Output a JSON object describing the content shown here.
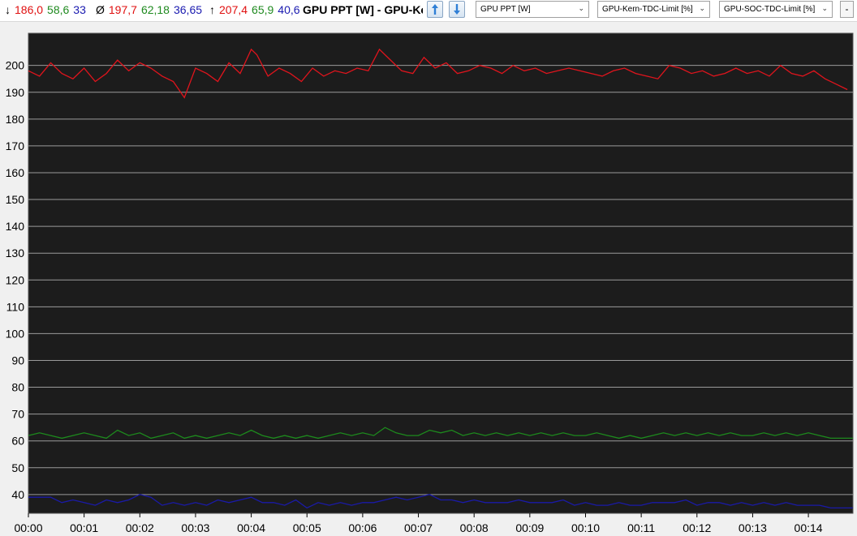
{
  "stats": {
    "min": {
      "symbol": "↓",
      "v1": "186,0",
      "v2": "58,6",
      "v3": "33"
    },
    "avg": {
      "symbol": "Ø",
      "v1": "197,7",
      "v2": "62,18",
      "v3": "36,65"
    },
    "max": {
      "symbol": "↑",
      "v1": "207,4",
      "v2": "65,9",
      "v3": "40,6"
    }
  },
  "title": "GPU PPT [W]  -  GPU-Kern-TDC-Limit [%]",
  "icons": {
    "up": "arrow-up-icon",
    "down": "arrow-down-icon"
  },
  "selectors": [
    {
      "value": "GPU PPT [W]"
    },
    {
      "value": "GPU-Kern-TDC-Limit [%]"
    },
    {
      "value": "GPU-SOC-TDC-Limit [%]"
    }
  ],
  "minus_label": "-",
  "colors": {
    "plot_bg": "#1c1c1c",
    "grid": "#9a9a9a",
    "red": "#e0141c",
    "green": "#1d8a1d",
    "blue": "#1a1aa8"
  },
  "chart_data": {
    "type": "line",
    "ylim": [
      33,
      212
    ],
    "yticks": [
      40,
      50,
      60,
      70,
      80,
      90,
      100,
      110,
      120,
      130,
      140,
      150,
      160,
      170,
      180,
      190,
      200
    ],
    "xlim": [
      0,
      14.8
    ],
    "xticks": [
      "00:00",
      "00:01",
      "00:02",
      "00:03",
      "00:04",
      "00:05",
      "00:06",
      "00:07",
      "00:08",
      "00:09",
      "00:10",
      "00:11",
      "00:12",
      "00:13",
      "00:14"
    ],
    "grid": true,
    "series": [
      {
        "color": "#e0141c",
        "x": [
          0,
          0.2,
          0.4,
          0.6,
          0.8,
          1.0,
          1.2,
          1.4,
          1.6,
          1.8,
          2.0,
          2.2,
          2.4,
          2.6,
          2.8,
          3.0,
          3.2,
          3.4,
          3.6,
          3.8,
          4.0,
          4.1,
          4.3,
          4.5,
          4.7,
          4.9,
          5.1,
          5.3,
          5.5,
          5.7,
          5.9,
          6.1,
          6.3,
          6.5,
          6.7,
          6.9,
          7.1,
          7.3,
          7.5,
          7.7,
          7.9,
          8.1,
          8.3,
          8.5,
          8.7,
          8.9,
          9.1,
          9.3,
          9.5,
          9.7,
          9.9,
          10.1,
          10.3,
          10.5,
          10.7,
          10.9,
          11.1,
          11.3,
          11.5,
          11.7,
          11.9,
          12.1,
          12.3,
          12.5,
          12.7,
          12.9,
          13.1,
          13.3,
          13.5,
          13.7,
          13.9,
          14.1,
          14.3,
          14.5,
          14.7
        ],
        "values": [
          198,
          196,
          201,
          197,
          195,
          199,
          194,
          197,
          202,
          198,
          201,
          199,
          196,
          194,
          188,
          199,
          197,
          194,
          201,
          197,
          206,
          204,
          196,
          199,
          197,
          194,
          199,
          196,
          198,
          197,
          199,
          198,
          206,
          202,
          198,
          197,
          203,
          199,
          201,
          197,
          198,
          200,
          199,
          197,
          200,
          198,
          199,
          197,
          198,
          199,
          198,
          197,
          196,
          198,
          199,
          197,
          196,
          195,
          200,
          199,
          197,
          198,
          196,
          197,
          199,
          197,
          198,
          196,
          200,
          197,
          196,
          198,
          195,
          193,
          191
        ]
      },
      {
        "color": "#1d8a1d",
        "x": [
          0,
          0.2,
          0.4,
          0.6,
          0.8,
          1.0,
          1.2,
          1.4,
          1.6,
          1.8,
          2.0,
          2.2,
          2.4,
          2.6,
          2.8,
          3.0,
          3.2,
          3.4,
          3.6,
          3.8,
          4.0,
          4.2,
          4.4,
          4.6,
          4.8,
          5.0,
          5.2,
          5.4,
          5.6,
          5.8,
          6.0,
          6.2,
          6.4,
          6.6,
          6.8,
          7.0,
          7.2,
          7.4,
          7.6,
          7.8,
          8.0,
          8.2,
          8.4,
          8.6,
          8.8,
          9.0,
          9.2,
          9.4,
          9.6,
          9.8,
          10.0,
          10.2,
          10.4,
          10.6,
          10.8,
          11.0,
          11.2,
          11.4,
          11.6,
          11.8,
          12.0,
          12.2,
          12.4,
          12.6,
          12.8,
          13.0,
          13.2,
          13.4,
          13.6,
          13.8,
          14.0,
          14.2,
          14.4,
          14.6,
          14.8
        ],
        "values": [
          62,
          63,
          62,
          61,
          62,
          63,
          62,
          61,
          64,
          62,
          63,
          61,
          62,
          63,
          61,
          62,
          61,
          62,
          63,
          62,
          64,
          62,
          61,
          62,
          61,
          62,
          61,
          62,
          63,
          62,
          63,
          62,
          65,
          63,
          62,
          62,
          64,
          63,
          64,
          62,
          63,
          62,
          63,
          62,
          63,
          62,
          63,
          62,
          63,
          62,
          62,
          63,
          62,
          61,
          62,
          61,
          62,
          63,
          62,
          63,
          62,
          63,
          62,
          63,
          62,
          62,
          63,
          62,
          63,
          62,
          63,
          62,
          61,
          61,
          61
        ]
      },
      {
        "color": "#1a1aa8",
        "x": [
          0,
          0.2,
          0.4,
          0.6,
          0.8,
          1.0,
          1.2,
          1.4,
          1.6,
          1.8,
          2.0,
          2.2,
          2.4,
          2.6,
          2.8,
          3.0,
          3.2,
          3.4,
          3.6,
          3.8,
          4.0,
          4.2,
          4.4,
          4.6,
          4.8,
          5.0,
          5.2,
          5.4,
          5.6,
          5.8,
          6.0,
          6.2,
          6.4,
          6.6,
          6.8,
          7.0,
          7.2,
          7.4,
          7.6,
          7.8,
          8.0,
          8.2,
          8.4,
          8.6,
          8.8,
          9.0,
          9.2,
          9.4,
          9.6,
          9.8,
          10.0,
          10.2,
          10.4,
          10.6,
          10.8,
          11.0,
          11.2,
          11.4,
          11.6,
          11.8,
          12.0,
          12.2,
          12.4,
          12.6,
          12.8,
          13.0,
          13.2,
          13.4,
          13.6,
          13.8,
          14.0,
          14.2,
          14.4,
          14.6,
          14.8
        ],
        "values": [
          39,
          39,
          39,
          37,
          38,
          37,
          36,
          38,
          37,
          38,
          40,
          39,
          36,
          37,
          36,
          37,
          36,
          38,
          37,
          38,
          39,
          37,
          37,
          36,
          38,
          35,
          37,
          36,
          37,
          36,
          37,
          37,
          38,
          39,
          38,
          39,
          40,
          38,
          38,
          37,
          38,
          37,
          37,
          37,
          38,
          37,
          37,
          37,
          38,
          36,
          37,
          36,
          36,
          37,
          36,
          36,
          37,
          37,
          37,
          38,
          36,
          37,
          37,
          36,
          37,
          36,
          37,
          36,
          37,
          36,
          36,
          36,
          35,
          35,
          35
        ]
      }
    ]
  }
}
